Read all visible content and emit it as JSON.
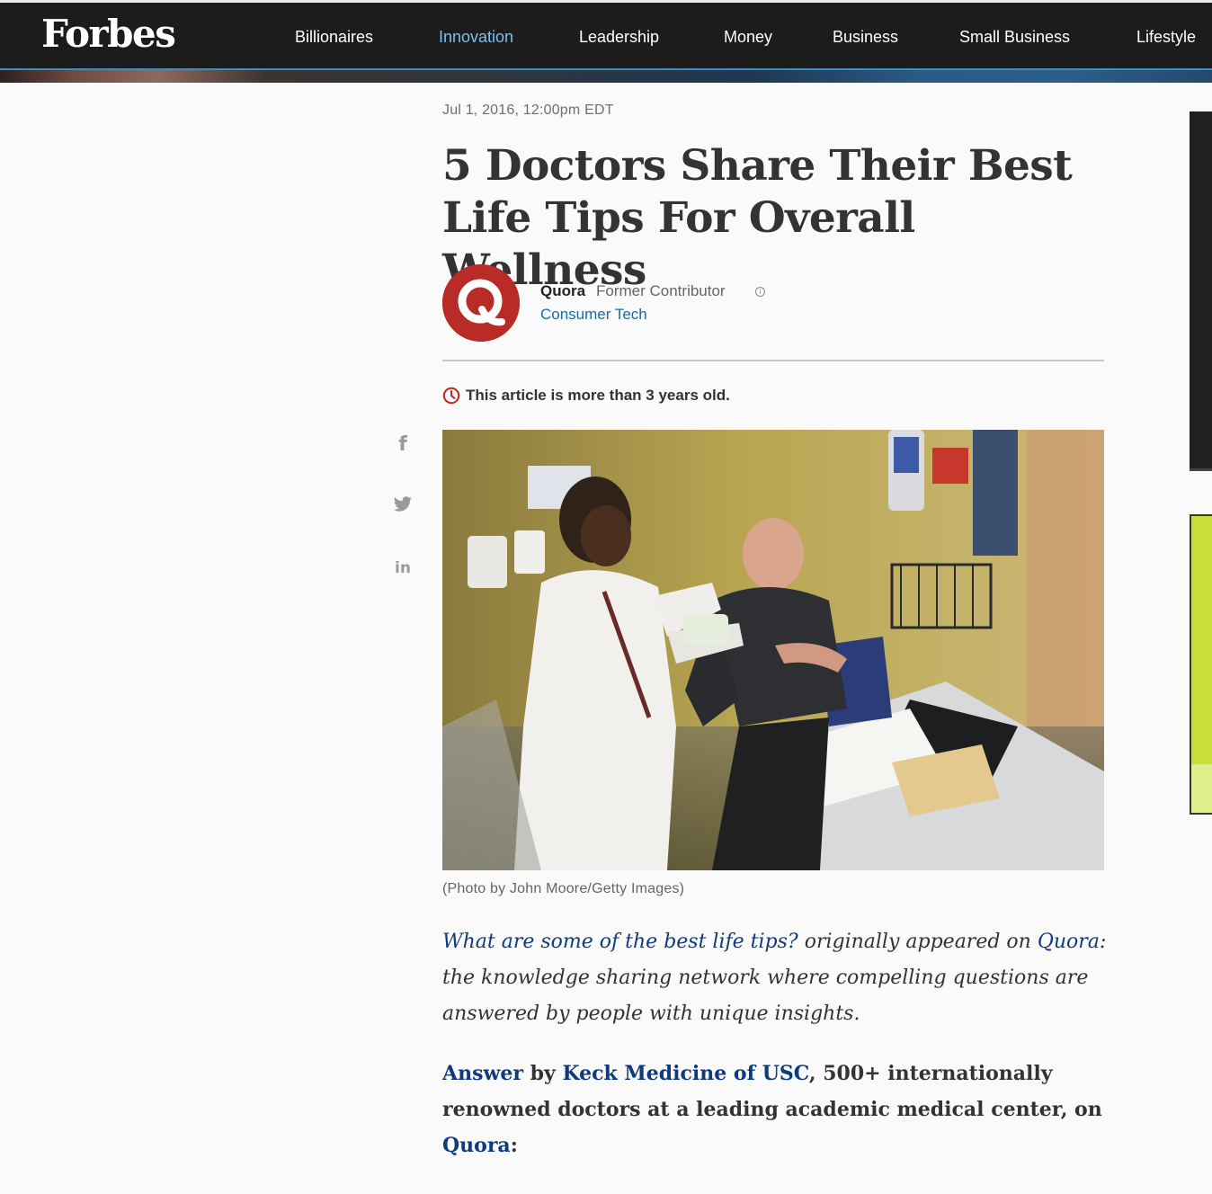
{
  "header": {
    "logo": "Forbes",
    "nav": [
      {
        "label": "Billionaires",
        "active": false
      },
      {
        "label": "Innovation",
        "active": true
      },
      {
        "label": "Leadership",
        "active": false
      },
      {
        "label": "Money",
        "active": false
      },
      {
        "label": "Business",
        "active": false
      },
      {
        "label": "Small Business",
        "active": false
      },
      {
        "label": "Lifestyle",
        "active": false
      }
    ]
  },
  "article": {
    "date": "Jul 1, 2016, 12:00pm EDT",
    "headline_line1": "5 Doctors Share Their Best",
    "headline_line2": "Life Tips For Overall Wellness",
    "author": {
      "avatar_letter": "Q",
      "name": "Quora",
      "role": "Former Contributor",
      "channel": "Consumer Tech"
    },
    "age_notice": "This article is more than 3 years old.",
    "photo_caption": "(Photo by John Moore/Getty Images)",
    "intro": {
      "question_link": "What are some of the best life tips?",
      "text1": " originally appeared on ",
      "quora_link": "Quora",
      "text2": ": the knowledge sharing network where compelling questions are answered by people with unique insights."
    },
    "answer": {
      "answer_link": "Answer",
      "text1": " by ",
      "author_link": "Keck Medicine of USC",
      "text2": ", 500+ internationally renowned doctors at a leading academic medical center, on ",
      "quora_link": "Quora",
      "text3": ":"
    }
  },
  "share": {
    "icons": [
      "facebook-icon",
      "twitter-icon",
      "linkedin-icon"
    ],
    "facebook_glyph": "f",
    "linkedin_glyph": "in"
  },
  "colors": {
    "header_bg": "#1c1c1c",
    "nav_active": "#7cc1ea",
    "link_blue": "#0e3a7e",
    "channel_blue": "#1b6aa5",
    "quora_red": "#b92b27",
    "rail_green": "#c9e03a"
  }
}
